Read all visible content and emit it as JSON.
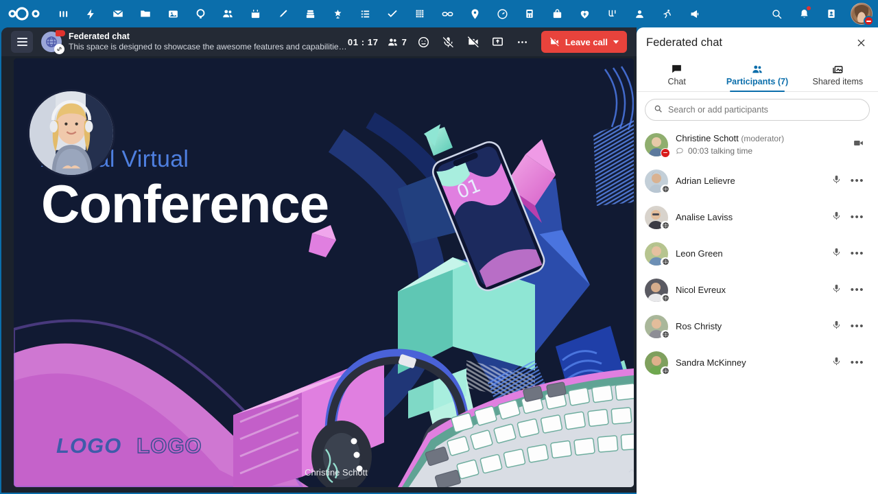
{
  "topbar": {
    "logo_name": "nextcloud-logo",
    "apps": [
      {
        "name": "dashboard",
        "icon": "dashboard-icon"
      },
      {
        "name": "activity",
        "icon": "lightning-icon"
      },
      {
        "name": "mail",
        "icon": "mail-icon"
      },
      {
        "name": "files",
        "icon": "folder-icon"
      },
      {
        "name": "photos",
        "icon": "photos-icon"
      },
      {
        "name": "talk",
        "icon": "talk-icon"
      },
      {
        "name": "contacts",
        "icon": "contacts-icon"
      },
      {
        "name": "calendar",
        "icon": "calendar-icon"
      },
      {
        "name": "notes",
        "icon": "pencil-icon"
      },
      {
        "name": "deck",
        "icon": "deck-icon"
      },
      {
        "name": "collectives",
        "icon": "collectives-icon"
      },
      {
        "name": "tables",
        "icon": "list-icon"
      },
      {
        "name": "tasks",
        "icon": "check-icon"
      },
      {
        "name": "office",
        "icon": "grid-icon"
      },
      {
        "name": "bookmarks",
        "icon": "link-icon"
      },
      {
        "name": "maps",
        "icon": "map-pin-icon"
      },
      {
        "name": "analytics",
        "icon": "gauge-icon"
      },
      {
        "name": "forms",
        "icon": "forms-icon"
      },
      {
        "name": "cospend",
        "icon": "briefcase-icon"
      },
      {
        "name": "polls",
        "icon": "heart-icon"
      },
      {
        "name": "flow",
        "icon": "flow-icon"
      },
      {
        "name": "profile",
        "icon": "person-icon"
      },
      {
        "name": "fitness",
        "icon": "activity-icon"
      },
      {
        "name": "announcements",
        "icon": "megaphone-icon"
      }
    ],
    "right": [
      {
        "name": "search",
        "icon": "search-icon"
      },
      {
        "name": "notifications",
        "icon": "bell-icon"
      },
      {
        "name": "contacts-menu",
        "icon": "contacts-card-icon"
      }
    ],
    "user_status": "do-not-disturb"
  },
  "call": {
    "menu_label": "menu-icon",
    "conversation_title": "Federated chat",
    "conversation_description": "This space is designed to showcase the awesome features and capabilities of federate...",
    "timer": "01 : 17",
    "participant_count": "7",
    "controls": [
      {
        "name": "reactions-button",
        "icon": "emoji-icon"
      },
      {
        "name": "microphone-button",
        "icon": "mic-off-icon"
      },
      {
        "name": "camera-button",
        "icon": "camera-off-icon"
      },
      {
        "name": "screenshare-button",
        "icon": "screen-share-icon"
      },
      {
        "name": "more-actions-button",
        "icon": "ellipsis-icon"
      }
    ],
    "leave_label": "Leave call",
    "speaker_name": "Christine Schott",
    "collapse_label": "collapse-icon"
  },
  "slide": {
    "kicker": "Annual Virtual",
    "title": "Conference",
    "phone_number": "01",
    "logo_primary": "LOGO",
    "logo_secondary": "LOGO"
  },
  "sidebar": {
    "title": "Federated chat",
    "close_label": "close-icon",
    "tabs": [
      {
        "label": "Chat",
        "icon": "chat-icon",
        "active": false
      },
      {
        "label": "Participants (7)",
        "icon": "participants-icon",
        "active": true
      },
      {
        "label": "Shared items",
        "icon": "shared-items-icon",
        "active": false
      }
    ],
    "search_placeholder": "Search or add participants",
    "participants": [
      {
        "name": "Christine Schott",
        "role": "(moderator)",
        "talking_time": "00:03 talking time",
        "status": "dnd",
        "federated": false,
        "actions": [
          "camera-icon"
        ],
        "avatar_colors": [
          "#8fae6e",
          "#e7c9a8",
          "#5d7a9e"
        ]
      },
      {
        "name": "Adrian Lelievre",
        "role": "",
        "talking_time": "",
        "status": "none",
        "federated": true,
        "actions": [
          "mic-icon",
          "ellipsis-icon"
        ],
        "avatar_colors": [
          "#c3cfd8",
          "#d9b291",
          "#2b2b33"
        ]
      },
      {
        "name": "Analise Laviss",
        "role": "",
        "talking_time": "",
        "status": "none",
        "federated": true,
        "actions": [
          "mic-icon",
          "ellipsis-icon"
        ],
        "avatar_colors": [
          "#d8d3cc",
          "#e3bd9b",
          "#3b3b44"
        ]
      },
      {
        "name": "Leon Green",
        "role": "",
        "talking_time": "",
        "status": "none",
        "federated": true,
        "actions": [
          "mic-icon",
          "ellipsis-icon"
        ],
        "avatar_colors": [
          "#b6c48f",
          "#e5c0a0",
          "#6d8fb5"
        ]
      },
      {
        "name": "Nicol Evreux",
        "role": "",
        "talking_time": "",
        "status": "none",
        "federated": true,
        "actions": [
          "mic-icon",
          "ellipsis-icon"
        ],
        "avatar_colors": [
          "#5a5a62",
          "#d6ad8c",
          "#e8e8ea"
        ]
      },
      {
        "name": "Ros Christy",
        "role": "",
        "talking_time": "",
        "status": "none",
        "federated": true,
        "actions": [
          "mic-icon",
          "ellipsis-icon"
        ],
        "avatar_colors": [
          "#a9b79a",
          "#e3bd9b",
          "#8d8d95"
        ]
      },
      {
        "name": "Sandra McKinney",
        "role": "",
        "talking_time": "",
        "status": "none",
        "federated": true,
        "actions": [
          "mic-icon",
          "ellipsis-icon"
        ],
        "avatar_colors": [
          "#7fa05e",
          "#e0b08b",
          "#a8572c"
        ]
      }
    ]
  },
  "colors": {
    "brand_blue": "#0b6eab",
    "call_bg": "#1b222c",
    "call_header": "#242a35",
    "leave_red": "#e8433c",
    "slide_navy": "#111a33",
    "slide_kicker_blue": "#4e7fe0"
  }
}
